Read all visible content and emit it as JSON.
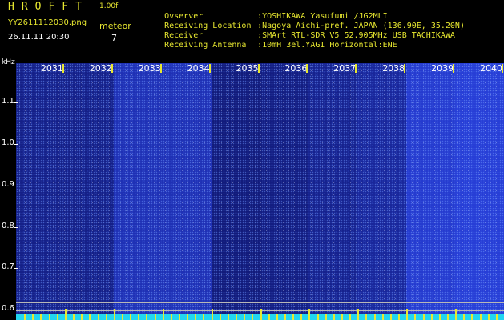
{
  "header": {
    "app_title": "HROFFT",
    "version": "1.00f",
    "filename": "YY2611112030.png",
    "datetime": "26.11.11 20:30",
    "mode_label": "meteor",
    "mode_value": "7"
  },
  "info": [
    {
      "key": "Ovserver",
      "value": ":YOSHIKAWA Yasufumi /JG2MLI"
    },
    {
      "key": "Receiving Location",
      "value": ":Nagoya Aichi-pref. JAPAN (136.90E, 35.20N)"
    },
    {
      "key": "Receiver",
      "value": ":SMArt RTL-SDR V5 52.905MHz USB TACHIKAWA"
    },
    {
      "key": "Receiving Antenna",
      "value": ":10mH 3el.YAGI Horizontal:ENE"
    }
  ],
  "chart_data": {
    "type": "heatmap",
    "y_unit": "kHz",
    "y_ticks": [
      "1.1",
      "1.0",
      "0.9",
      "0.8",
      "0.7",
      "0.6"
    ],
    "ylim": [
      0.575,
      1.195
    ],
    "x_ticks": [
      "2031",
      "2032",
      "2033",
      "2034",
      "2035",
      "2036",
      "2037",
      "2038",
      "2039",
      "2040"
    ],
    "x_range_minutes": [
      2030,
      2040
    ],
    "band_intensity": [
      0.35,
      0.35,
      0.7,
      0.7,
      0.25,
      0.3,
      0.4,
      0.5,
      0.9,
      0.95
    ],
    "reference_lines_khz": [
      0.618,
      0.598
    ],
    "colors": {
      "background": "#000000",
      "text_primary": "#e8e830",
      "text_secondary": "#ffffff",
      "noise_low": "#0a0a60",
      "noise_high": "#3a5cff",
      "baseline": "#22d6f0",
      "tick": "#e8e830"
    }
  }
}
